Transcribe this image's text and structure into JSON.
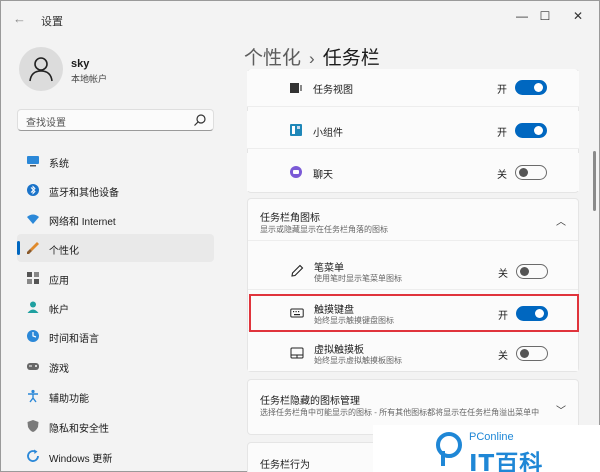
{
  "window": {
    "title": "设置",
    "back_glyph": "←",
    "minimize_glyph": "—",
    "maximize_glyph": "☐",
    "close_glyph": "✕"
  },
  "user": {
    "name": "sky",
    "account_type": "本地帐户"
  },
  "search": {
    "placeholder": "查找设置"
  },
  "sidebar": {
    "items": [
      {
        "label": "系统",
        "icon": "monitor-icon"
      },
      {
        "label": "蓝牙和其他设备",
        "icon": "bluetooth-icon"
      },
      {
        "label": "网络和 Internet",
        "icon": "wifi-icon"
      },
      {
        "label": "个性化",
        "icon": "brush-icon",
        "active": true
      },
      {
        "label": "应用",
        "icon": "apps-icon"
      },
      {
        "label": "帐户",
        "icon": "account-icon"
      },
      {
        "label": "时间和语言",
        "icon": "globe-clock-icon"
      },
      {
        "label": "游戏",
        "icon": "gamepad-icon"
      },
      {
        "label": "辅助功能",
        "icon": "accessibility-icon"
      },
      {
        "label": "隐私和安全性",
        "icon": "shield-icon"
      },
      {
        "label": "Windows 更新",
        "icon": "update-icon"
      }
    ]
  },
  "breadcrumb": {
    "parent": "个性化",
    "separator": "›",
    "current": "任务栏"
  },
  "taskbar_items": [
    {
      "label": "任务视图",
      "state": "开",
      "on": true,
      "icon": "task-view-icon"
    },
    {
      "label": "小组件",
      "state": "开",
      "on": true,
      "icon": "widgets-icon"
    },
    {
      "label": "聊天",
      "state": "关",
      "on": false,
      "icon": "chat-icon"
    }
  ],
  "corner_icons": {
    "title": "任务栏角图标",
    "subtitle": "显示或隐藏显示在任务栏角落的图标",
    "collapse_glyph": "︿",
    "items": [
      {
        "label": "笔菜单",
        "sub": "使用笔时显示笔菜单图标",
        "state": "关",
        "on": false,
        "icon": "pen-icon"
      },
      {
        "label": "触摸键盘",
        "sub": "始终显示触摸键盘图标",
        "state": "开",
        "on": true,
        "icon": "keyboard-icon"
      },
      {
        "label": "虚拟触摸板",
        "sub": "始终显示虚拟触摸板图标",
        "state": "关",
        "on": false,
        "icon": "touchpad-icon"
      }
    ]
  },
  "hidden_icons": {
    "title": "任务栏隐藏的图标管理",
    "subtitle": "选择任务栏角中可能显示的图标 - 所有其他图标都将显示在任务栏角溢出菜单中",
    "expand_glyph": "﹀"
  },
  "behaviors": {
    "title": "任务栏行为"
  },
  "watermark": {
    "top": "PConline",
    "bottom": "IT百科"
  },
  "colors": {
    "accent": "#0067c0",
    "highlight": "#e0343c",
    "background": "#f3f3f3",
    "card": "#fbfbfb"
  }
}
